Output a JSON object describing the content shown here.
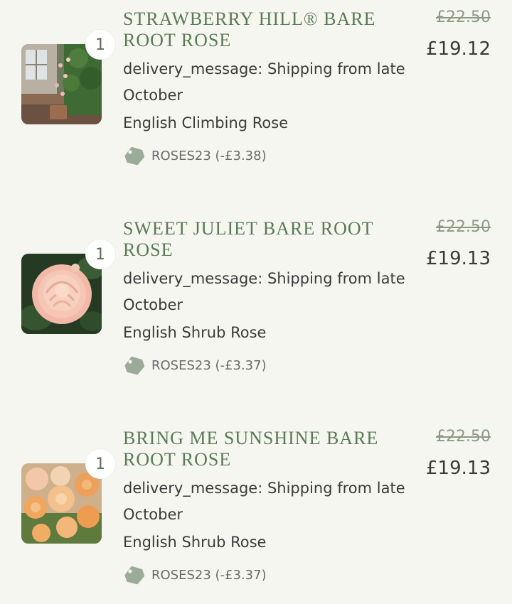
{
  "items": [
    {
      "title_line1": "STRAWBERRY HILL® BARE",
      "title_line2": "ROOT ROSE",
      "quantity": "1",
      "delivery_line1": "delivery_message: Shipping from late",
      "delivery_line2": "October",
      "variety": "English Climbing Rose",
      "discount": "ROSES23 (-£3.38)",
      "original_price": "£22.50",
      "price": "£19.12"
    },
    {
      "title_line1": "SWEET JULIET BARE ROOT",
      "title_line2": "ROSE",
      "quantity": "1",
      "delivery_line1": "delivery_message: Shipping from late",
      "delivery_line2": "October",
      "variety": "English Shrub Rose",
      "discount": "ROSES23 (-£3.37)",
      "original_price": "£22.50",
      "price": "£19.13"
    },
    {
      "title_line1": "BRING ME SUNSHINE BARE",
      "title_line2": "ROOT ROSE",
      "quantity": "1",
      "delivery_line1": "delivery_message: Shipping from late",
      "delivery_line2": "October",
      "variety": "English Shrub Rose",
      "discount": "ROSES23 (-£3.37)",
      "original_price": "£22.50",
      "price": "£19.13"
    }
  ],
  "colors": {
    "background": "#f6f6f1",
    "title": "#5a7a55",
    "strike_price": "#8a9a84",
    "tag_icon": "#9aab98"
  },
  "icons": {
    "discount": "tag-icon"
  }
}
